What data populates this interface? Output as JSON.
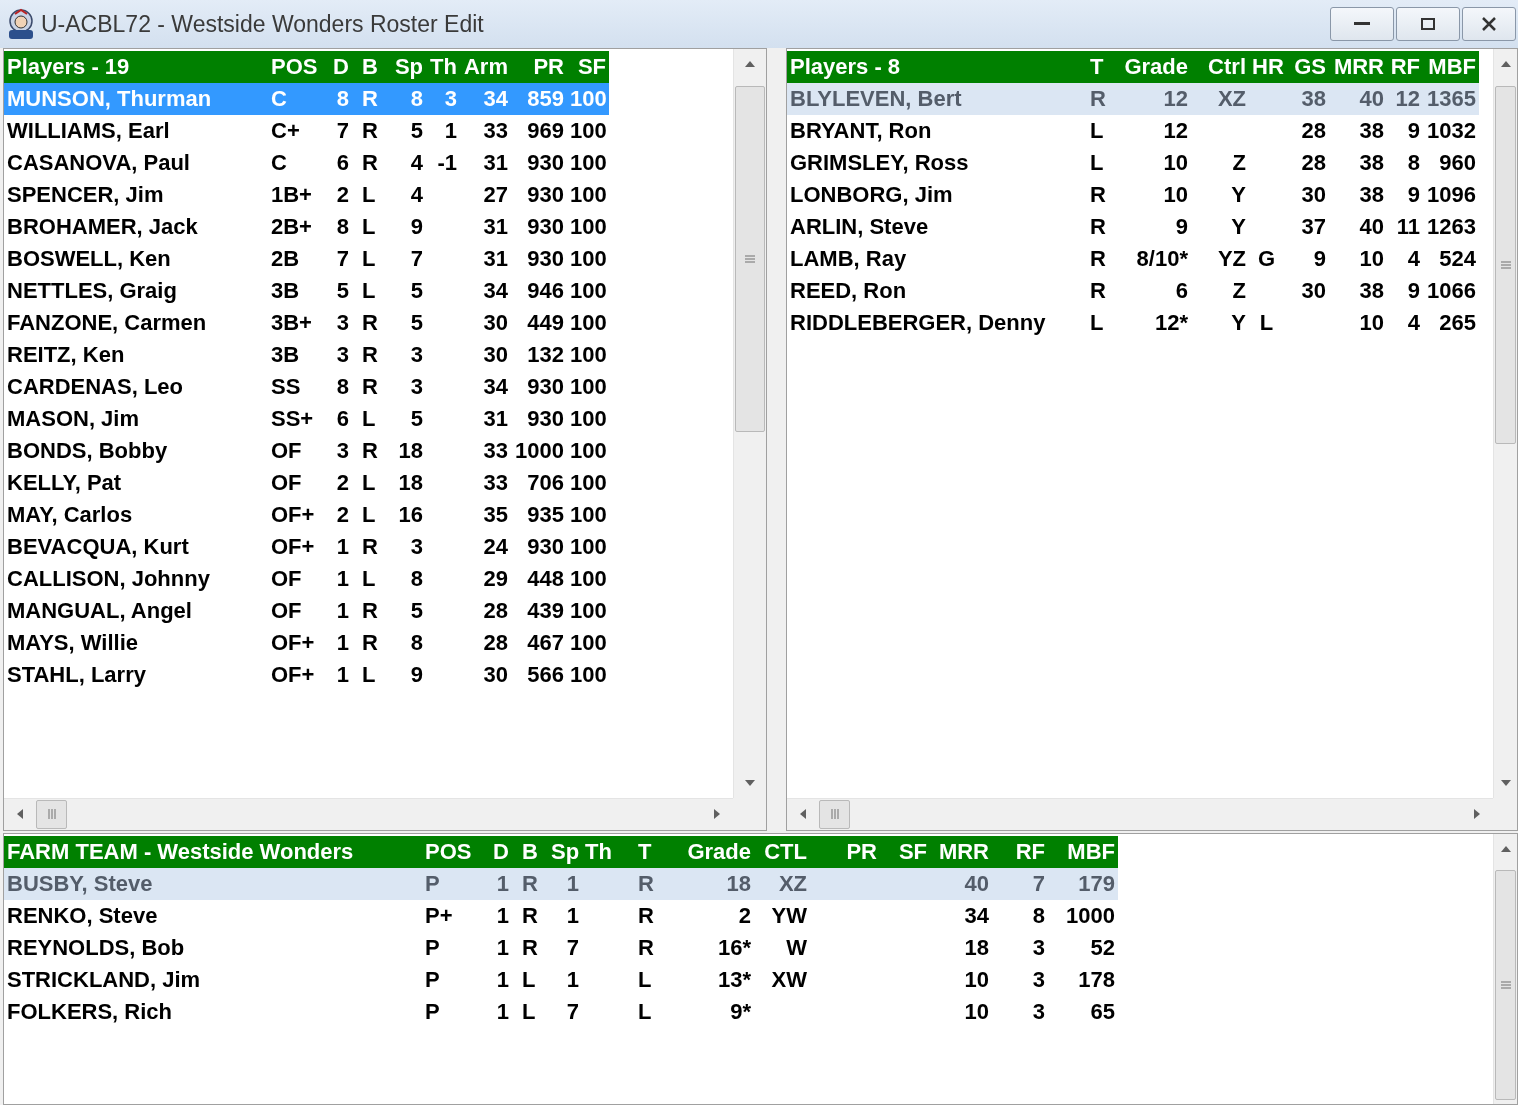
{
  "window": {
    "title": "U-ACBL72 - Westside Wonders Roster Edit"
  },
  "panes": [
    {
      "focused": true,
      "columns": [
        "Players - 19",
        "POS",
        "D",
        "B",
        "Sp",
        "Th",
        "Arm",
        "PR",
        "SF"
      ],
      "rows": [
        {
          "selected": true,
          "cells": [
            "MUNSON, Thurman",
            "C",
            "8",
            "R",
            "8",
            "3",
            "34",
            "859",
            "100"
          ]
        },
        {
          "selected": false,
          "cells": [
            "WILLIAMS, Earl",
            "C+",
            "7",
            "R",
            "5",
            "1",
            "33",
            "969",
            "100"
          ]
        },
        {
          "selected": false,
          "cells": [
            "CASANOVA, Paul",
            "C",
            "6",
            "R",
            "4",
            "-1",
            "31",
            "930",
            "100"
          ]
        },
        {
          "selected": false,
          "cells": [
            "SPENCER, Jim",
            "1B+",
            "2",
            "L",
            "4",
            null,
            "27",
            "930",
            "100"
          ]
        },
        {
          "selected": false,
          "cells": [
            "BROHAMER, Jack",
            "2B+",
            "8",
            "L",
            "9",
            null,
            "31",
            "930",
            "100"
          ]
        },
        {
          "selected": false,
          "cells": [
            "BOSWELL, Ken",
            "2B",
            "7",
            "L",
            "7",
            null,
            "31",
            "930",
            "100"
          ]
        },
        {
          "selected": false,
          "cells": [
            "NETTLES, Graig",
            "3B",
            "5",
            "L",
            "5",
            null,
            "34",
            "946",
            "100"
          ]
        },
        {
          "selected": false,
          "cells": [
            "FANZONE, Carmen",
            "3B+",
            "3",
            "R",
            "5",
            null,
            "30",
            "449",
            "100"
          ]
        },
        {
          "selected": false,
          "cells": [
            "REITZ, Ken",
            "3B",
            "3",
            "R",
            "3",
            null,
            "30",
            "132",
            "100"
          ]
        },
        {
          "selected": false,
          "cells": [
            "CARDENAS, Leo",
            "SS",
            "8",
            "R",
            "3",
            null,
            "34",
            "930",
            "100"
          ]
        },
        {
          "selected": false,
          "cells": [
            "MASON, Jim",
            "SS+",
            "6",
            "L",
            "5",
            null,
            "31",
            "930",
            "100"
          ]
        },
        {
          "selected": false,
          "cells": [
            "BONDS, Bobby",
            "OF",
            "3",
            "R",
            "18",
            null,
            "33",
            "1000",
            "100"
          ]
        },
        {
          "selected": false,
          "cells": [
            "KELLY, Pat",
            "OF",
            "2",
            "L",
            "18",
            null,
            "33",
            "706",
            "100"
          ]
        },
        {
          "selected": false,
          "cells": [
            "MAY, Carlos",
            "OF+",
            "2",
            "L",
            "16",
            null,
            "35",
            "935",
            "100"
          ]
        },
        {
          "selected": false,
          "cells": [
            "BEVACQUA, Kurt",
            "OF+",
            "1",
            "R",
            "3",
            null,
            "24",
            "930",
            "100"
          ]
        },
        {
          "selected": false,
          "cells": [
            "CALLISON, Johnny",
            "OF",
            "1",
            "L",
            "8",
            null,
            "29",
            "448",
            "100"
          ]
        },
        {
          "selected": false,
          "cells": [
            "MANGUAL, Angel",
            "OF",
            "1",
            "R",
            "5",
            null,
            "28",
            "439",
            "100"
          ]
        },
        {
          "selected": false,
          "cells": [
            "MAYS, Willie",
            "OF+",
            "1",
            "R",
            "8",
            null,
            "28",
            "467",
            "100"
          ]
        },
        {
          "selected": false,
          "cells": [
            "STAHL, Larry",
            "OF+",
            "1",
            "L",
            "9",
            null,
            "30",
            "566",
            "100"
          ]
        }
      ]
    },
    {
      "focused": false,
      "columns": [
        "Players - 8",
        "T",
        "Grade",
        "Ctrl",
        "HR",
        "GS",
        "MRR",
        "RF",
        "MBF"
      ],
      "rows": [
        {
          "selected": true,
          "cells": [
            "BLYLEVEN, Bert",
            "R",
            "12",
            "XZ",
            null,
            "38",
            "40",
            "12",
            "1365"
          ]
        },
        {
          "selected": false,
          "cells": [
            "BRYANT, Ron",
            "L",
            "12",
            null,
            null,
            "28",
            "38",
            "9",
            "1032"
          ]
        },
        {
          "selected": false,
          "cells": [
            "GRIMSLEY, Ross",
            "L",
            "10",
            "Z",
            null,
            "28",
            "38",
            "8",
            "960"
          ]
        },
        {
          "selected": false,
          "cells": [
            "LONBORG, Jim",
            "R",
            "10",
            "Y",
            null,
            "30",
            "38",
            "9",
            "1096"
          ]
        },
        {
          "selected": false,
          "cells": [
            "ARLIN, Steve",
            "R",
            "9",
            "Y",
            null,
            "37",
            "40",
            "11",
            "1263"
          ]
        },
        {
          "selected": false,
          "cells": [
            "LAMB, Ray",
            "R",
            "8/10*",
            "YZ",
            "G",
            "9",
            "10",
            "4",
            "524"
          ]
        },
        {
          "selected": false,
          "cells": [
            "REED, Ron",
            "R",
            "6",
            "Z",
            null,
            "30",
            "38",
            "9",
            "1066"
          ]
        },
        {
          "selected": false,
          "cells": [
            "RIDDLEBERGER, Denny",
            "L",
            "12*",
            "Y",
            "L",
            null,
            "10",
            "4",
            "265"
          ]
        }
      ]
    },
    {
      "focused": false,
      "columns": [
        "FARM TEAM - Westside Wonders",
        "POS",
        "D",
        "B",
        "Sp",
        "Th",
        "T",
        "Grade",
        "CTL",
        "PR",
        "SF",
        "MRR",
        "RF",
        "MBF"
      ],
      "rows": [
        {
          "selected": true,
          "cells": [
            "BUSBY, Steve",
            "P",
            "1",
            "R",
            "1",
            null,
            "R",
            "18",
            "XZ",
            null,
            null,
            "40",
            "7",
            "179"
          ]
        },
        {
          "selected": false,
          "cells": [
            "RENKO, Steve",
            "P+",
            "1",
            "R",
            "1",
            null,
            "R",
            "2",
            "YW",
            null,
            null,
            "34",
            "8",
            "1000"
          ]
        },
        {
          "selected": false,
          "cells": [
            "REYNOLDS, Bob",
            "P",
            "1",
            "R",
            "7",
            null,
            "R",
            "16*",
            "W",
            null,
            null,
            "18",
            "3",
            "52"
          ]
        },
        {
          "selected": false,
          "cells": [
            "STRICKLAND, Jim",
            "P",
            "1",
            "L",
            "1",
            null,
            "L",
            "13*",
            "XW",
            null,
            null,
            "10",
            "3",
            "178"
          ]
        },
        {
          "selected": false,
          "cells": [
            "FOLKERS, Rich",
            "P",
            "1",
            "L",
            "7",
            null,
            "L",
            "9*",
            null,
            null,
            null,
            "10",
            "3",
            "65"
          ]
        }
      ]
    }
  ]
}
